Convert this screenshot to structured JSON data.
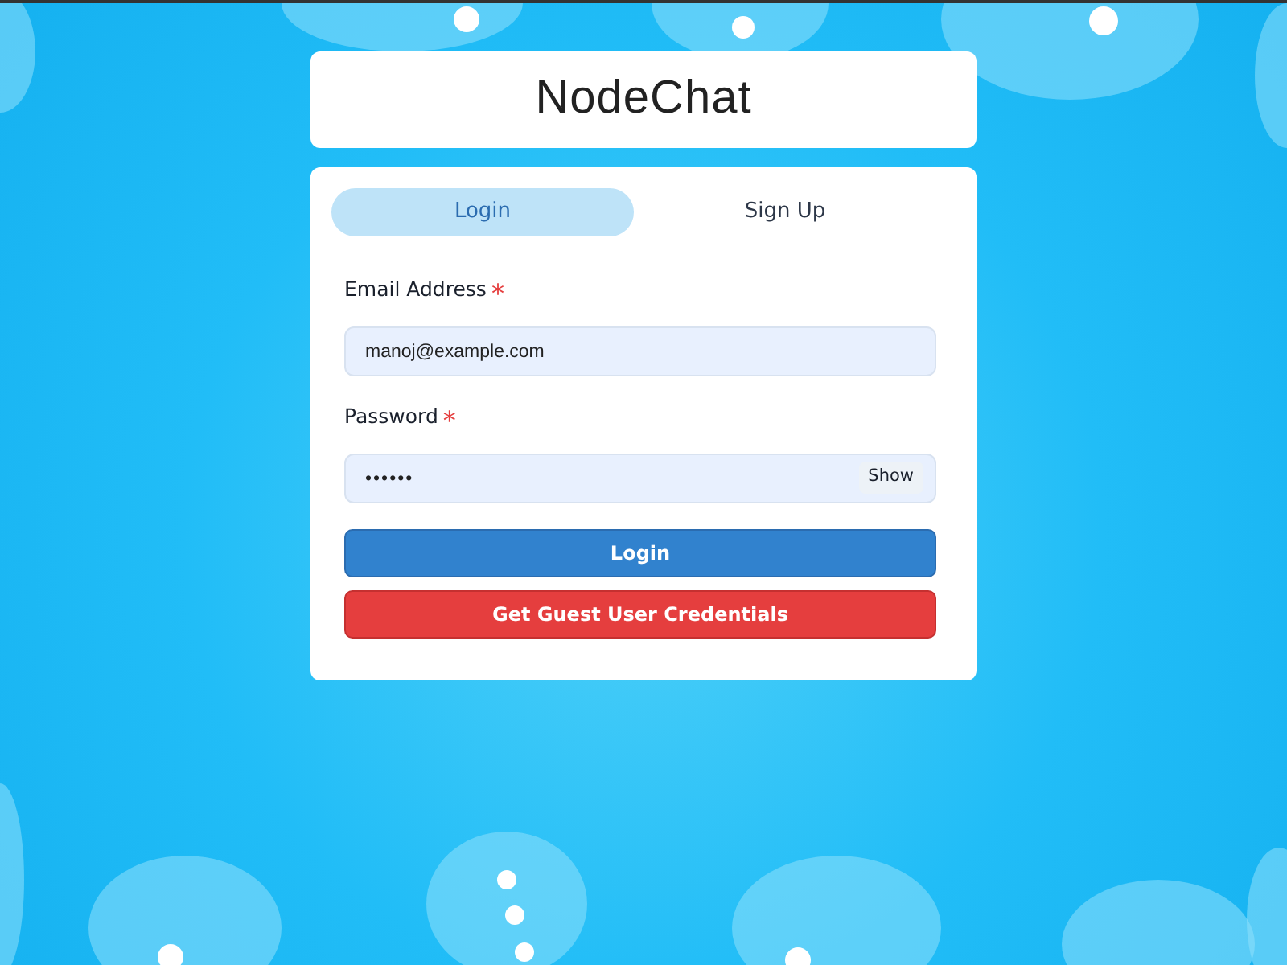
{
  "header": {
    "title": "NodeChat"
  },
  "tabs": [
    {
      "label": "Login",
      "selected": true
    },
    {
      "label": "Sign Up",
      "selected": false
    }
  ],
  "fields": [
    {
      "label": "Email Address",
      "required_mark": "*",
      "value": "manoj@example.com",
      "kind": "text"
    },
    {
      "label": "Password",
      "required_mark": "*",
      "value": "••••••",
      "kind": "password",
      "toggle": "Show"
    }
  ],
  "buttons": [
    {
      "label": "Login",
      "kind": "primary"
    },
    {
      "label": "Get Guest User Credentials",
      "kind": "danger"
    }
  ]
}
